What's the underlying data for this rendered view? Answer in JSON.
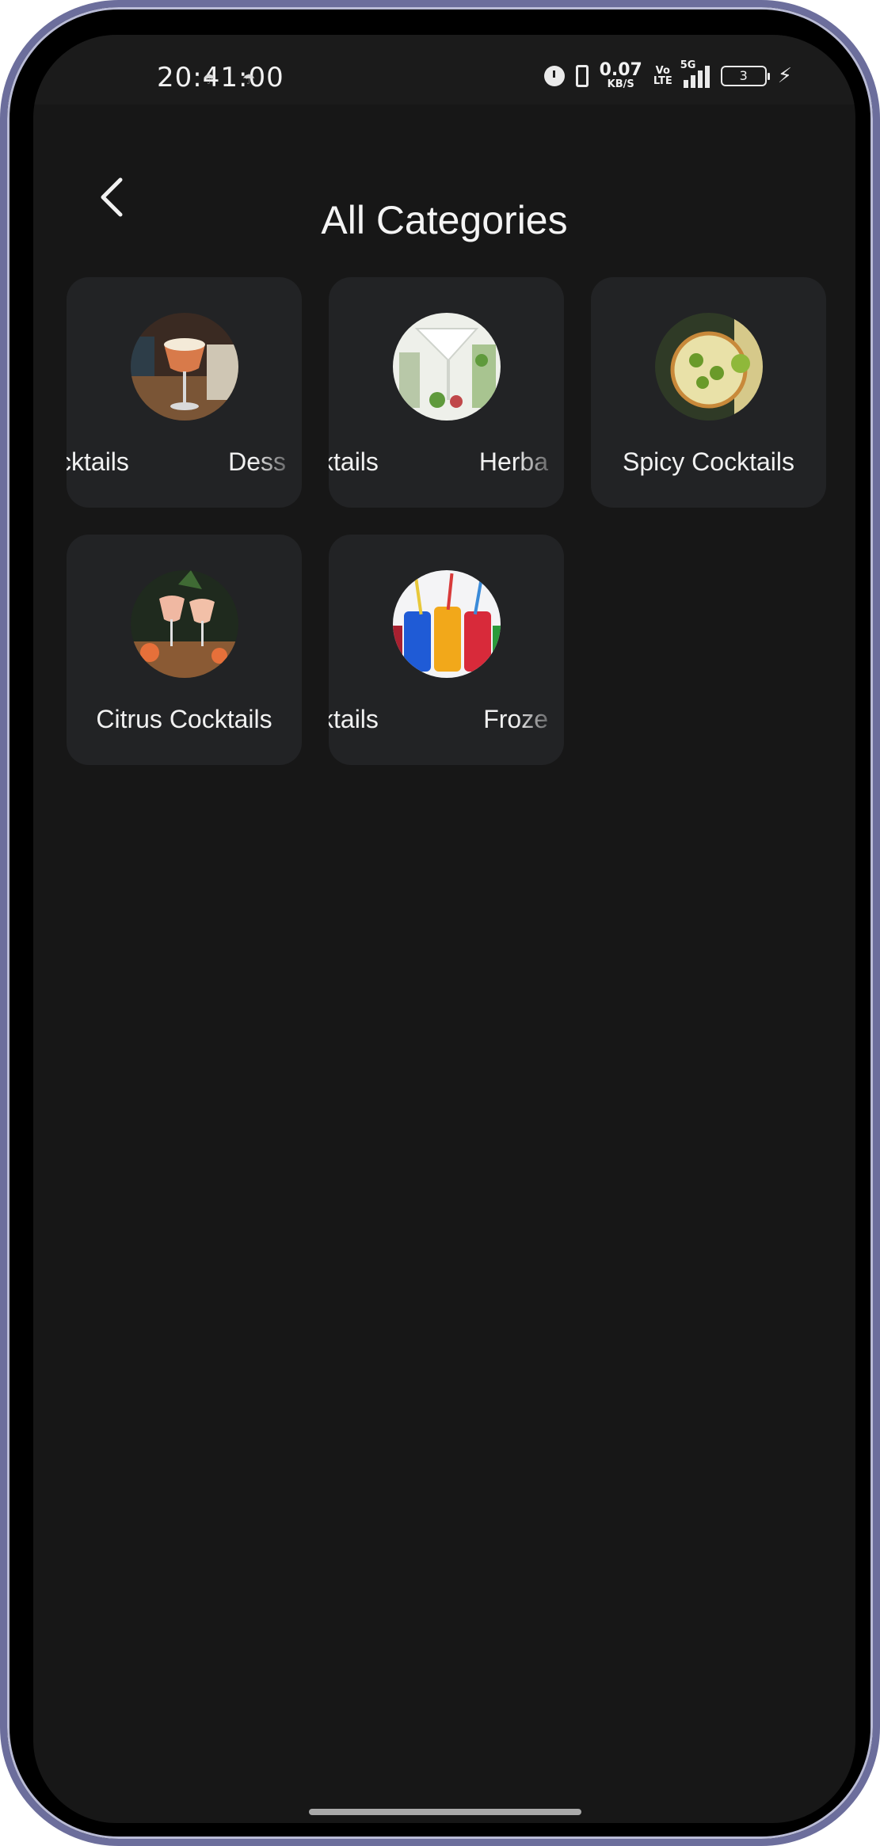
{
  "status_bar": {
    "time": "20:41:00",
    "net_speed_value": "0.07",
    "net_speed_unit": "KB/S",
    "volte_top": "Vo",
    "volte_bottom": "LTE",
    "network": "5G",
    "battery": "3"
  },
  "header": {
    "title": "All Categories",
    "back_icon": "chevron-left-icon"
  },
  "categories": [
    {
      "label_left": "cktails",
      "label_right": "Dess",
      "image": "dessert-cocktail-photo",
      "marquee": true
    },
    {
      "label_left": "ktails",
      "label_right": "Herba",
      "image": "herbal-cocktail-photo",
      "marquee": true
    },
    {
      "label": "Spicy Cocktails",
      "image": "spicy-cocktail-photo",
      "marquee": false
    },
    {
      "label": "Citrus Cocktails",
      "image": "citrus-cocktail-photo",
      "marquee": false
    },
    {
      "label_left": "ktails",
      "label_right": "Froze",
      "image": "frozen-cocktail-photo",
      "marquee": true
    }
  ],
  "colors": {
    "background": "#171717",
    "card": "#222325",
    "text": "#f1f1f1",
    "frame": "#6c6e9c"
  }
}
